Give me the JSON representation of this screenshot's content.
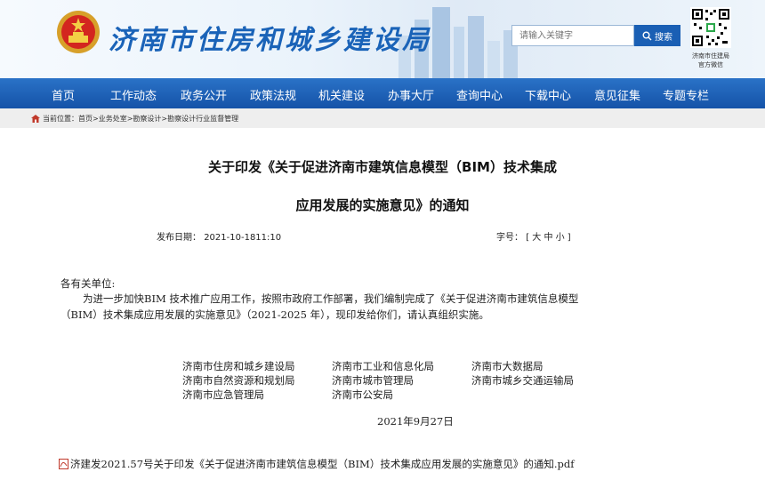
{
  "header": {
    "site_title": "济南市住房和城乡建设局",
    "search_placeholder": "请输入关键字",
    "search_button": "搜索",
    "qr_caption_line1": "济南市住建局",
    "qr_caption_line2": "官方微信"
  },
  "nav": {
    "items": [
      "首页",
      "工作动态",
      "政务公开",
      "政策法规",
      "机关建设",
      "办事大厅",
      "查询中心",
      "下载中心",
      "意见征集",
      "专题专栏"
    ]
  },
  "breadcrumb": {
    "label": "当前位置：",
    "path": [
      "首页",
      "业务处室",
      "勘察设计",
      "勘察设计行业监督管理"
    ],
    "separator": ">"
  },
  "article": {
    "title_line1": "关于印发《关于促进济南市建筑信息模型（BIM）技术集成",
    "title_line2": "应用发展的实施意见》的通知",
    "publish_label": "发布日期：",
    "publish_date": "2021-10-1811:10",
    "font_label": "字号：",
    "font_options": "[ 大 中 小 ]",
    "salutation": "各有关单位:",
    "body_line1": "为进一步加快BIM 技术推广应用工作，按照市政府工作部署，我们编制完成了《关于促进济南市建筑信息模型",
    "body_line2": "（BIM）技术集成应用发展的实施意见》（2021-2025 年），现印发给你们，请认真组织实施。",
    "signatories": [
      [
        "济南市住房和城乡建设局",
        "济南市工业和信息化局",
        "济南市大数据局"
      ],
      [
        "济南市自然资源和规划局",
        "济南市城市管理局",
        "济南市城乡交通运输局"
      ],
      [
        "济南市应急管理局",
        "济南市公安局",
        ""
      ]
    ],
    "sign_date": "2021年9月27日",
    "attachment": "济建发2021.57号关于印发《关于促进济南市建筑信息模型（BIM）技术集成应用发展的实施意见》的通知.pdf"
  },
  "colors": {
    "nav_blue": "#1a5fb4",
    "title_blue": "#1a63b8",
    "breadcrumb_bg": "#eeeeee"
  }
}
